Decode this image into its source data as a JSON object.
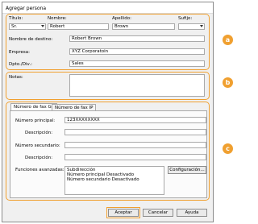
{
  "window": {
    "title": "Agregar persona"
  },
  "badges": {
    "a": "a",
    "b": "b",
    "c": "c"
  },
  "name_section": {
    "title_label": "Título:",
    "title_value": "Sr.",
    "first_name_label": "Nombre:",
    "first_name_value": "Robert",
    "last_name_label": "Apellido:",
    "last_name_value": "Brown",
    "suffix_label": "Sufijo:",
    "suffix_value": "",
    "destination_label": "Nombre de destino:",
    "destination_value": "Robert Brown",
    "company_label": "Empresa:",
    "company_value": "XYZ Corporatoin",
    "department_label": "Dpto./Div.:",
    "department_value": "Sales"
  },
  "notes_section": {
    "label": "Notas:",
    "value": ""
  },
  "fax_section": {
    "tabs": [
      {
        "label": "Número de fax G3",
        "active": true
      },
      {
        "label": "Número de fax IP",
        "active": false
      }
    ],
    "main_number_label": "Número principal:",
    "main_number_value": "123XXXXXXXX",
    "description1_label": "Descripción:",
    "description1_value": "",
    "secondary_number_label": "Número secundario:",
    "secondary_number_value": "",
    "description2_label": "Descripción:",
    "description2_value": "",
    "advanced_label": "Funciones avanzadas:",
    "advanced_lines": [
      "Subdirección",
      "Número principal    Desactivado",
      "Número secundario  Desactivado"
    ],
    "config_button": "Configuración..."
  },
  "footer": {
    "accept_button": "Aceptar",
    "cancel_button": "Cancelar",
    "help_button": "Ayuda"
  },
  "colors": {
    "accent": "#f0a030"
  }
}
